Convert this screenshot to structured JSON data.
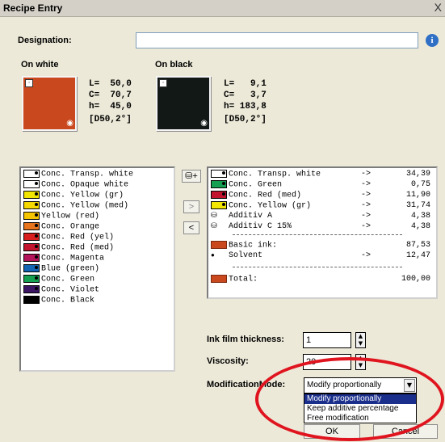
{
  "window": {
    "title": "Recipe Entry",
    "close": "X"
  },
  "designation": {
    "label": "Designation:",
    "value": ""
  },
  "on_white": {
    "label": "On white",
    "swatch_color": "#c9481e",
    "L": "L=  50,0",
    "C": "C=  70,7",
    "h": "h=  45,0",
    "illum": "[D50,2°]"
  },
  "on_black": {
    "label": "On black",
    "swatch_color": "#121816",
    "L": "L=   9,1",
    "C": "C=   3,7",
    "h": "h= 183,8",
    "illum": "[D50,2°]"
  },
  "left_list": [
    {
      "text": "Conc. Transp. white",
      "color": "#ffffff"
    },
    {
      "text": "Conc. Opaque white",
      "color": "#ffffff"
    },
    {
      "text": "Conc. Yellow (gr)",
      "color": "#f2e600"
    },
    {
      "text": "Conc. Yellow (med)",
      "color": "#f5d800"
    },
    {
      "text": "Yellow (red)",
      "color": "#f5c400"
    },
    {
      "text": "Conc. Orange",
      "color": "#e8741e"
    },
    {
      "text": "Conc. Red (yel)",
      "color": "#d81e1e"
    },
    {
      "text": "Conc. Red (med)",
      "color": "#c2142e"
    },
    {
      "text": "Conc. Magenta",
      "color": "#b4145a"
    },
    {
      "text": "Blue (green)",
      "color": "#1464b4"
    },
    {
      "text": "Conc. Green",
      "color": "#14a050"
    },
    {
      "text": "Conc. Violet",
      "color": "#3c1464"
    },
    {
      "text": "Conc. Black",
      "color": "#000000"
    }
  ],
  "right_list": [
    {
      "text": "Conc. Transp. white",
      "arrow": "->",
      "value": "34,39",
      "color": "#ffffff"
    },
    {
      "text": "Conc. Green",
      "arrow": "->",
      "value": "0,75",
      "color": "#14a050"
    },
    {
      "text": "Conc. Red (med)",
      "arrow": "->",
      "value": "11,90",
      "color": "#c2142e"
    },
    {
      "text": "Conc. Yellow (gr)",
      "arrow": "->",
      "value": "31,74",
      "color": "#f2e600"
    },
    {
      "text": "Additiv A",
      "arrow": "->",
      "value": "4,38"
    },
    {
      "text": "Additiv C 15%",
      "arrow": "->",
      "value": "4,38"
    }
  ],
  "basic_ink": {
    "label": "Basic ink:",
    "value": "87,53"
  },
  "solvent": {
    "label": "Solvent",
    "arrow": "->",
    "value": "12,47"
  },
  "total": {
    "label": "Total:",
    "value": "100,00"
  },
  "buttons": {
    "add_additive": "+",
    "move_right": ">",
    "move_left": "<",
    "ok": "OK",
    "cancel": "Cancel"
  },
  "ink_film": {
    "label": "Ink film thickness:",
    "value": "1"
  },
  "viscosity": {
    "label": "Viscosity:",
    "value": "20"
  },
  "modification": {
    "label": "ModificationMode:",
    "selected": "Modify proportionally",
    "options": [
      "Modify proportionally",
      "Keep additive percentage",
      "Free modification"
    ]
  },
  "accent_colors": {
    "annotation": "#e0141e",
    "selection": "#1a2e8c"
  }
}
